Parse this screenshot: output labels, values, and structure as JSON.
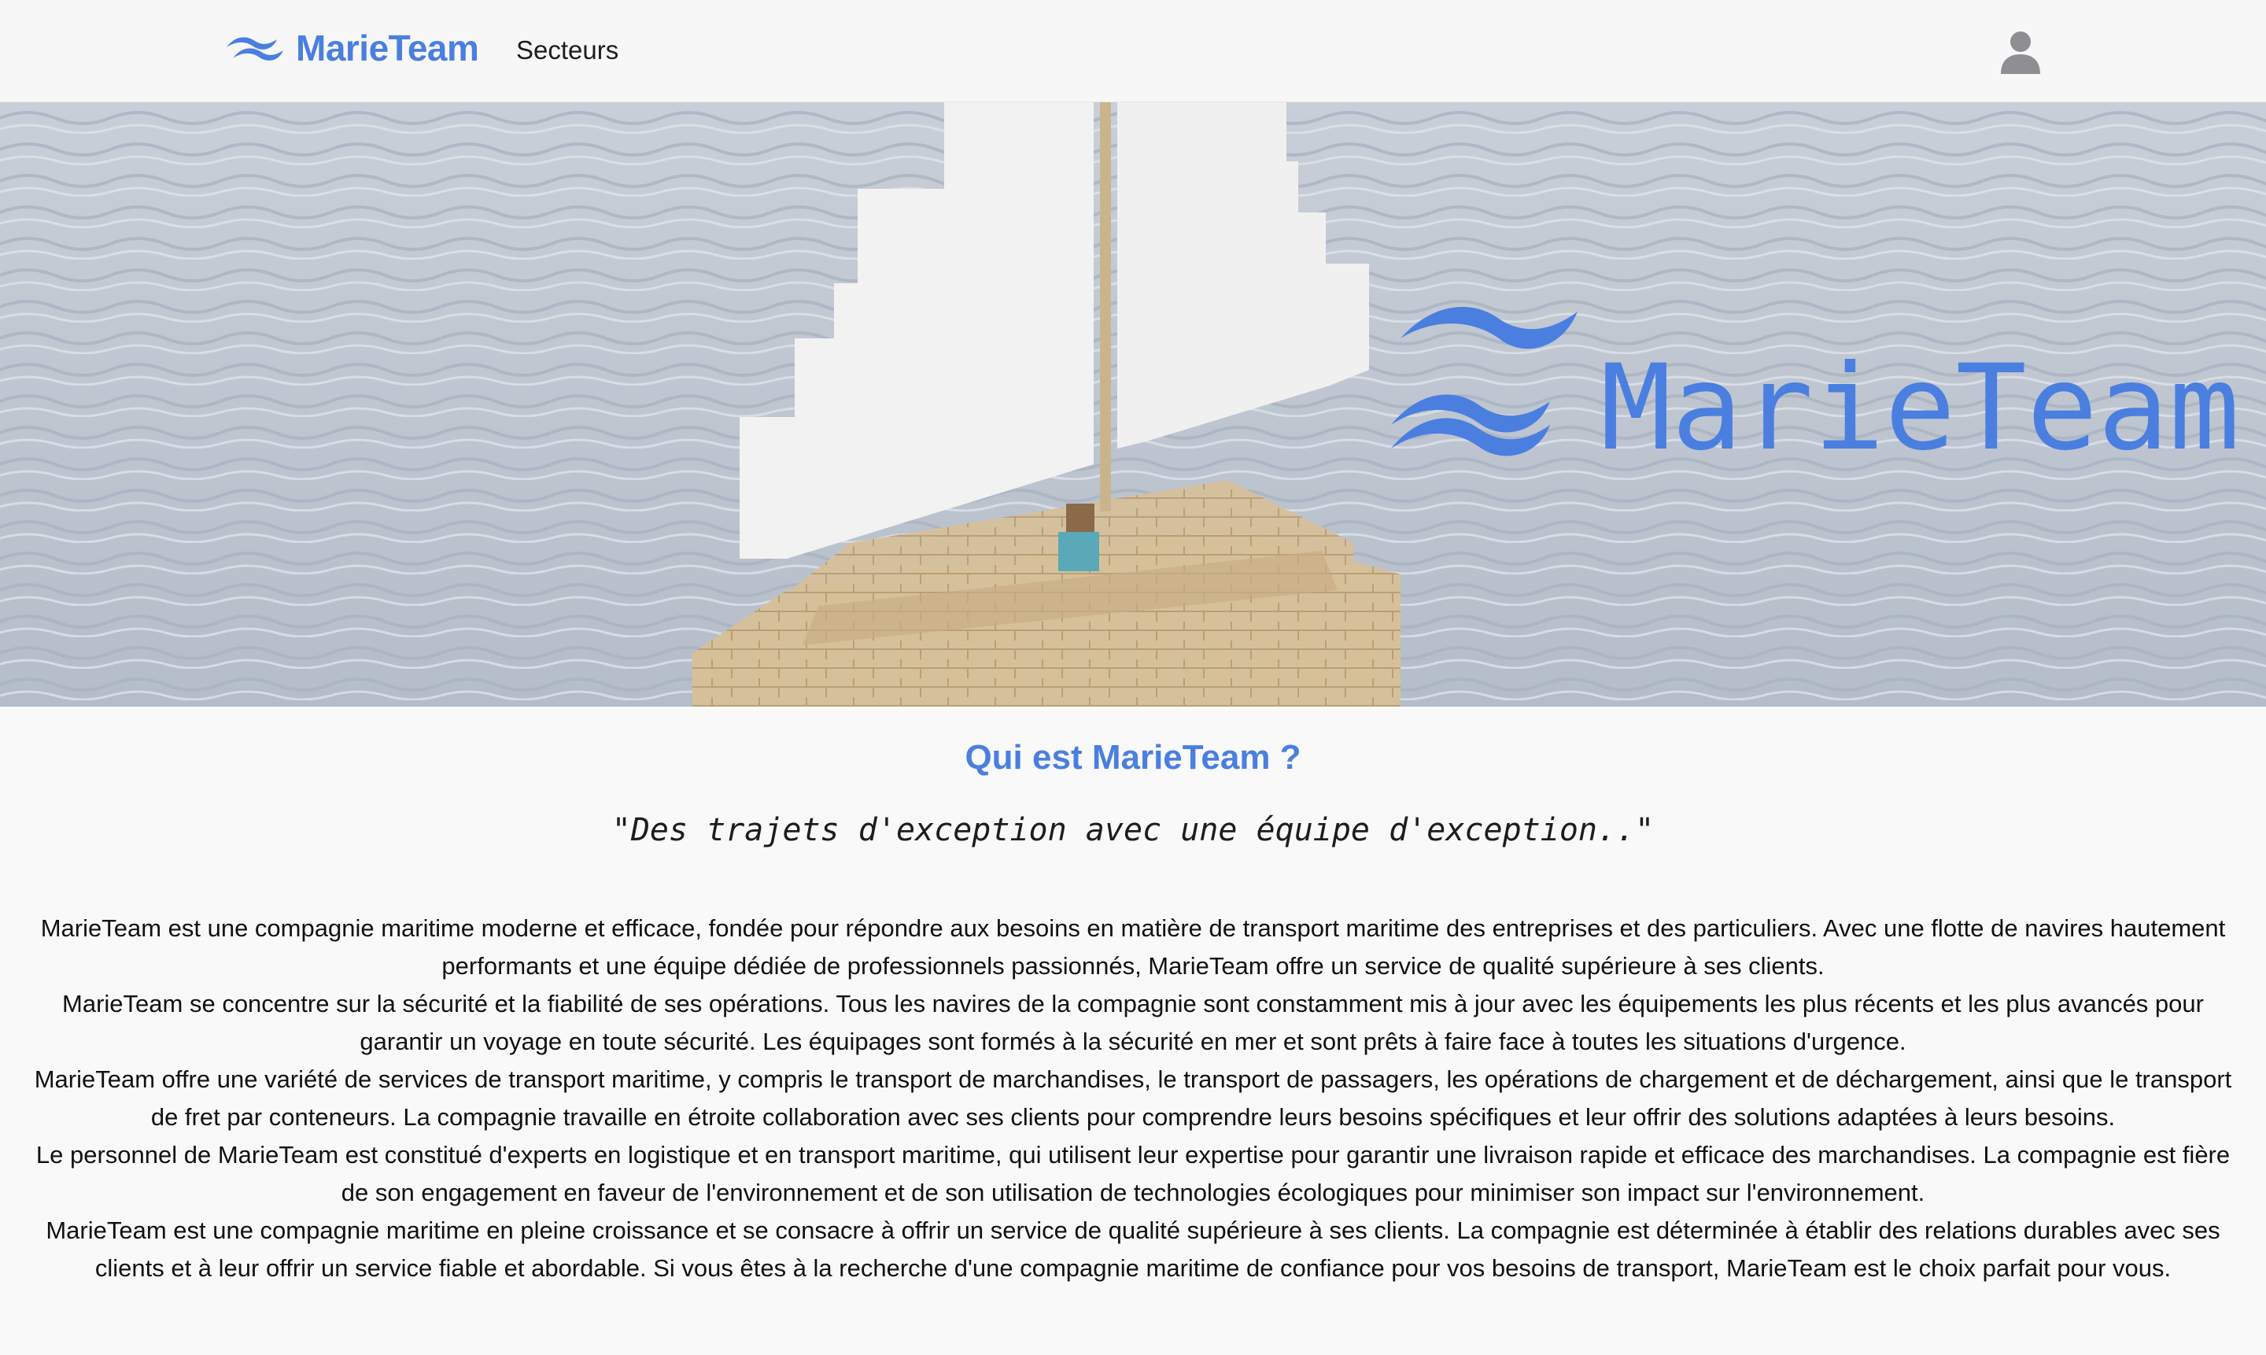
{
  "nav": {
    "brand": "MarieTeam",
    "links": [
      {
        "label": "Secteurs"
      }
    ],
    "user_icon": "user-icon"
  },
  "hero": {
    "overlay_logo_text": "MarieTeam"
  },
  "about": {
    "title": "Qui est MarieTeam ?",
    "quote": "\"Des trajets d'exception avec une équipe d'exception..\"",
    "paragraphs": [
      "MarieTeam est une compagnie maritime moderne et efficace, fondée pour répondre aux besoins en matière de transport maritime des entreprises et des particuliers. Avec une flotte de navires hautement performants et une équipe dédiée de professionnels passionnés, MarieTeam offre un service de qualité supérieure à ses clients.",
      "MarieTeam se concentre sur la sécurité et la fiabilité de ses opérations. Tous les navires de la compagnie sont constamment mis à jour avec les équipements les plus récents et les plus avancés pour garantir un voyage en toute sécurité. Les équipages sont formés à la sécurité en mer et sont prêts à faire face à toutes les situations d'urgence.",
      "MarieTeam offre une variété de services de transport maritime, y compris le transport de marchandises, le transport de passagers, les opérations de chargement et de déchargement, ainsi que le transport de fret par conteneurs. La compagnie travaille en étroite collaboration avec ses clients pour comprendre leurs besoins spécifiques et leur offrir des solutions adaptées à leurs besoins.",
      "Le personnel de MarieTeam est constitué d'experts en logistique et en transport maritime, qui utilisent leur expertise pour garantir une livraison rapide et efficace des marchandises. La compagnie est fière de son engagement en faveur de l'environnement et de son utilisation de technologies écologiques pour minimiser son impact sur l'environnement.",
      "MarieTeam est une compagnie maritime en pleine croissance et se consacre à offrir un service de qualité supérieure à ses clients. La compagnie est déterminée à établir des relations durables avec ses clients et à leur offrir un service fiable et abordable. Si vous êtes à la recherche d'une compagnie maritime de confiance pour vos besoins de transport, MarieTeam est le choix parfait pour vous."
    ]
  },
  "colors": {
    "brand": "#4a7fe0",
    "background": "#f9f9f9",
    "navbar": "#f7f7f8",
    "text": "#111111"
  }
}
